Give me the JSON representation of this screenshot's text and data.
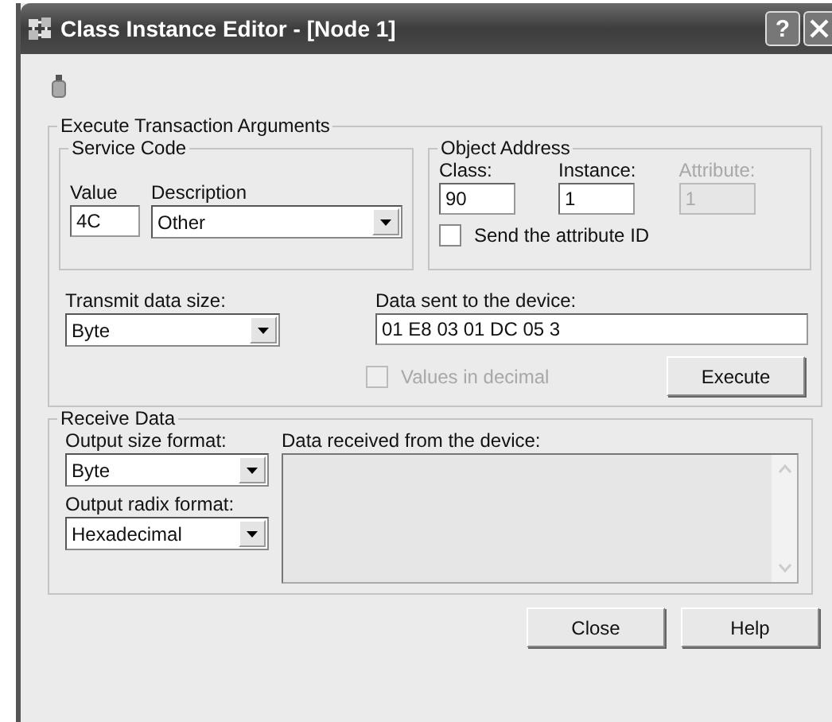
{
  "window": {
    "title": "Class Instance Editor - [Node 1]",
    "help_button": "?"
  },
  "execute": {
    "title": "Execute Transaction Arguments",
    "service_code": {
      "title": "Service Code",
      "value_label": "Value",
      "value": "4C",
      "description_label": "Description",
      "description": "Other"
    },
    "object_address": {
      "title": "Object Address",
      "fields": [
        {
          "label": "Class:",
          "value": "90",
          "disabled": false
        },
        {
          "label": "Instance:",
          "value": "1",
          "disabled": false
        },
        {
          "label": "Attribute:",
          "value": "1",
          "disabled": true
        }
      ],
      "send_attribute": {
        "label": "Send the attribute ID",
        "checked": false,
        "disabled": false
      }
    },
    "transmit_size": {
      "label": "Transmit data size:",
      "value": "Byte"
    },
    "data_sent": {
      "label": "Data sent to the device:",
      "value": "01 E8 03 01 DC 05 3"
    },
    "values_decimal": {
      "label": "Values in decimal",
      "checked": false,
      "disabled": true
    },
    "execute_button": "Execute"
  },
  "receive": {
    "title": "Receive Data",
    "output_size": {
      "label": "Output size format:",
      "value": "Byte"
    },
    "output_radix": {
      "label": "Output radix format:",
      "value": "Hexadecimal"
    },
    "data_received": {
      "label": "Data received from the device:"
    }
  },
  "buttons": [
    "Close",
    "Help"
  ]
}
